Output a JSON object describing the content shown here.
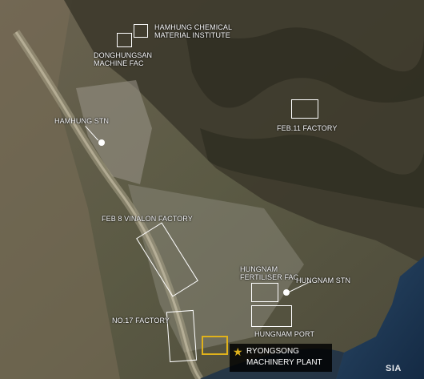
{
  "labels": {
    "chem_institute": "HAMHUNG CHEMICAL\nMATERIAL INSTITUTE",
    "donghungsan": "DONGHUNGSAN\nMACHINE FAC",
    "hamhung_stn": "HAMHUNG STN",
    "feb11": "FEB.11 FACTORY",
    "feb8": "FEB 8 VINALON FACTORY",
    "fertiliser": "HUNGNAM\nFERTILISER FAC",
    "hungnam_stn": "HUNGNAM STN",
    "no17": "NO.17 FACTORY",
    "port": "HUNGNAM PORT"
  },
  "callout": {
    "line1": "RYONGSONG",
    "line2": "MACHINERY PLANT"
  },
  "logo": "SIA",
  "colors": {
    "highlight": "#e0b21b",
    "box": "#ffffff",
    "sea": "#1c3550"
  }
}
